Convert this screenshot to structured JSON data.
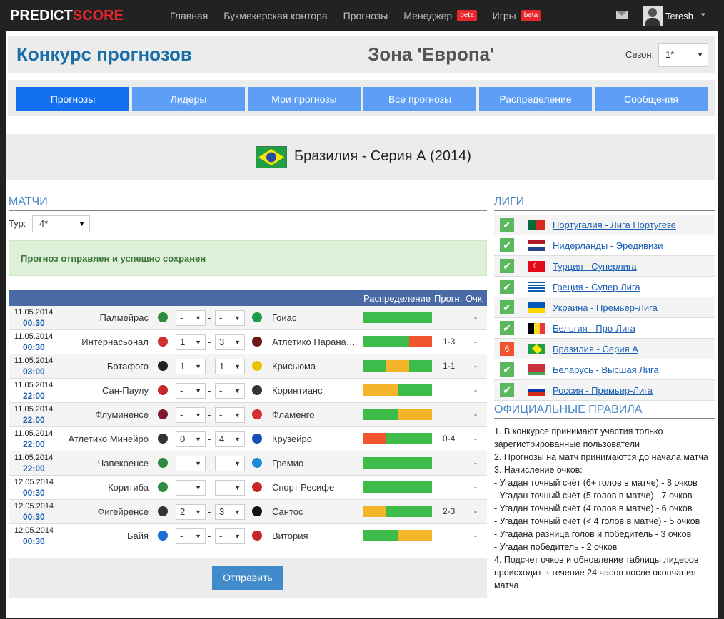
{
  "nav": {
    "logo_a": "PREDICT",
    "logo_b": "SCORE",
    "links": [
      {
        "label": "Главная",
        "beta": false
      },
      {
        "label": "Букмекерская контора",
        "beta": false
      },
      {
        "label": "Прогнозы",
        "beta": false
      },
      {
        "label": "Менеджер",
        "beta": true
      },
      {
        "label": "Игры",
        "beta": true
      }
    ],
    "beta_label": "beta",
    "user": "Teresh",
    "caret": "▾"
  },
  "hero": {
    "title": "Конкурс прогнозов",
    "zone": "Зона 'Европа'",
    "season_label": "Сезон:",
    "season_value": "1*"
  },
  "tabs": [
    "Прогнозы",
    "Лидеры",
    "Мои прогнозы",
    "Все прогнозы",
    "Распределение",
    "Сообщения"
  ],
  "league": {
    "title": "Бразилия - Серия А (2014)"
  },
  "matches_section": {
    "heading": "МАТЧИ",
    "tour_label": "Тур:",
    "tour_value": "4*",
    "alert": "Прогноз отправлен и успешно сохранен",
    "col_dist": "Распределение",
    "col_prog": "Прогн.",
    "col_pts": "Очк.",
    "rows": [
      {
        "date": "11.05.2014",
        "time": "00:30",
        "home": "Палмейрас",
        "away": "Гоиас",
        "h": "-",
        "a": "-",
        "prog": "",
        "pts": "-",
        "hc": "#2e8b3e",
        "ac": "#1f9c4a",
        "bar": [
          [
            "#3dbb4b",
            1
          ]
        ]
      },
      {
        "date": "11.05.2014",
        "time": "00:30",
        "home": "Интернасьонал",
        "away": "Атлетико Паранаэнсе",
        "h": "1",
        "a": "3",
        "prog": "1-3",
        "pts": "-",
        "hc": "#d32f2f",
        "ac": "#6b1a1a",
        "bar": [
          [
            "#3dbb4b",
            0.67
          ],
          [
            "#f0542f",
            0.33
          ]
        ]
      },
      {
        "date": "11.05.2014",
        "time": "03:00",
        "home": "Ботафого",
        "away": "Крисьюма",
        "h": "1",
        "a": "1",
        "prog": "1-1",
        "pts": "-",
        "hc": "#222",
        "ac": "#e8c400",
        "bar": [
          [
            "#3dbb4b",
            0.33
          ],
          [
            "#f5b52a",
            0.34
          ],
          [
            "#3dbb4b",
            0.33
          ]
        ]
      },
      {
        "date": "11.05.2014",
        "time": "22:00",
        "home": "Сан-Паулу",
        "away": "Коринтианс",
        "h": "-",
        "a": "-",
        "prog": "",
        "pts": "-",
        "hc": "#c62828",
        "ac": "#333",
        "bar": [
          [
            "#f5b52a",
            0.5
          ],
          [
            "#3dbb4b",
            0.5
          ]
        ]
      },
      {
        "date": "11.05.2014",
        "time": "22:00",
        "home": "Флуминенсе",
        "away": "Фламенго",
        "h": "-",
        "a": "-",
        "prog": "",
        "pts": "-",
        "hc": "#7a1a2e",
        "ac": "#d32f2f",
        "bar": [
          [
            "#3dbb4b",
            0.5
          ],
          [
            "#f5b52a",
            0.5
          ]
        ]
      },
      {
        "date": "11.05.2014",
        "time": "22:00",
        "home": "Атлетико Минейро",
        "away": "Крузейро",
        "h": "0",
        "a": "4",
        "prog": "0-4",
        "pts": "-",
        "hc": "#333",
        "ac": "#1a4fb4",
        "bar": [
          [
            "#f0542f",
            0.33
          ],
          [
            "#3dbb4b",
            0.67
          ]
        ]
      },
      {
        "date": "11.05.2014",
        "time": "22:00",
        "home": "Чапекоенсе",
        "away": "Гремио",
        "h": "-",
        "a": "-",
        "prog": "",
        "pts": "-",
        "hc": "#2e8b3e",
        "ac": "#1a8ad4",
        "bar": [
          [
            "#3dbb4b",
            1
          ]
        ]
      },
      {
        "date": "12.05.2014",
        "time": "00:30",
        "home": "Коритиба",
        "away": "Спорт Ресифе",
        "h": "-",
        "a": "-",
        "prog": "",
        "pts": "-",
        "hc": "#2e8b3e",
        "ac": "#c62828",
        "bar": [
          [
            "#3dbb4b",
            1
          ]
        ]
      },
      {
        "date": "12.05.2014",
        "time": "00:30",
        "home": "Фигейренсе",
        "away": "Сантос",
        "h": "2",
        "a": "3",
        "prog": "2-3",
        "pts": "-",
        "hc": "#333",
        "ac": "#111",
        "bar": [
          [
            "#f5b52a",
            0.33
          ],
          [
            "#3dbb4b",
            0.67
          ]
        ]
      },
      {
        "date": "12.05.2014",
        "time": "00:30",
        "home": "Байя",
        "away": "Витория",
        "h": "-",
        "a": "-",
        "prog": "",
        "pts": "-",
        "hc": "#1a6ed4",
        "ac": "#c62828",
        "bar": [
          [
            "#3dbb4b",
            0.5
          ],
          [
            "#f5b52a",
            0.5
          ]
        ]
      }
    ],
    "submit": "Отправить"
  },
  "leagues_section": {
    "heading": "ЛИГИ",
    "items": [
      {
        "name": "Португалия - Лига Португезе",
        "check": "✔",
        "flag": "pt"
      },
      {
        "name": "Нидерланды - Эредивизи",
        "check": "✔",
        "flag": "nl"
      },
      {
        "name": "Турция - Суперлига",
        "check": "✔",
        "flag": "tr"
      },
      {
        "name": "Греция - Супер Лига",
        "check": "✔",
        "flag": "gr"
      },
      {
        "name": "Украина - Премьер-Лига",
        "check": "✔",
        "flag": "ua"
      },
      {
        "name": "Бельгия - Про-Лига",
        "check": "✔",
        "flag": "be"
      },
      {
        "name": "Бразилия - Серия А",
        "check": "6",
        "flag": "br"
      },
      {
        "name": "Беларусь - Высшая Лига",
        "check": "✔",
        "flag": "by"
      },
      {
        "name": "Россия - Премьер-Лига",
        "check": "✔",
        "flag": "ru"
      }
    ]
  },
  "rules_section": {
    "heading": "ОФИЦИАЛЬНЫЕ ПРАВИЛА",
    "lines": [
      "1. В конкурсе принимают участия только зарегистрированные пользователи",
      "2. Прогнозы на матч принимаются до начала матча",
      "3. Начисление очков:",
      "- Угадан точный счёт (6+ голов в матче) - 8 очков",
      "- Угадан точный счёт (5 голов в матче) - 7 очков",
      "- Угадан точный счёт (4 голов в матче) - 6 очков",
      "- Угадан точный счёт (< 4 голов в матче) - 5 очков",
      "- Угадана разница голов и победитель - 3 очков",
      "- Угадан победитель - 2 очков",
      "4. Подсчет очков и обновление таблицы лидеров происходит в течение 24 часов после окончания матча"
    ]
  }
}
